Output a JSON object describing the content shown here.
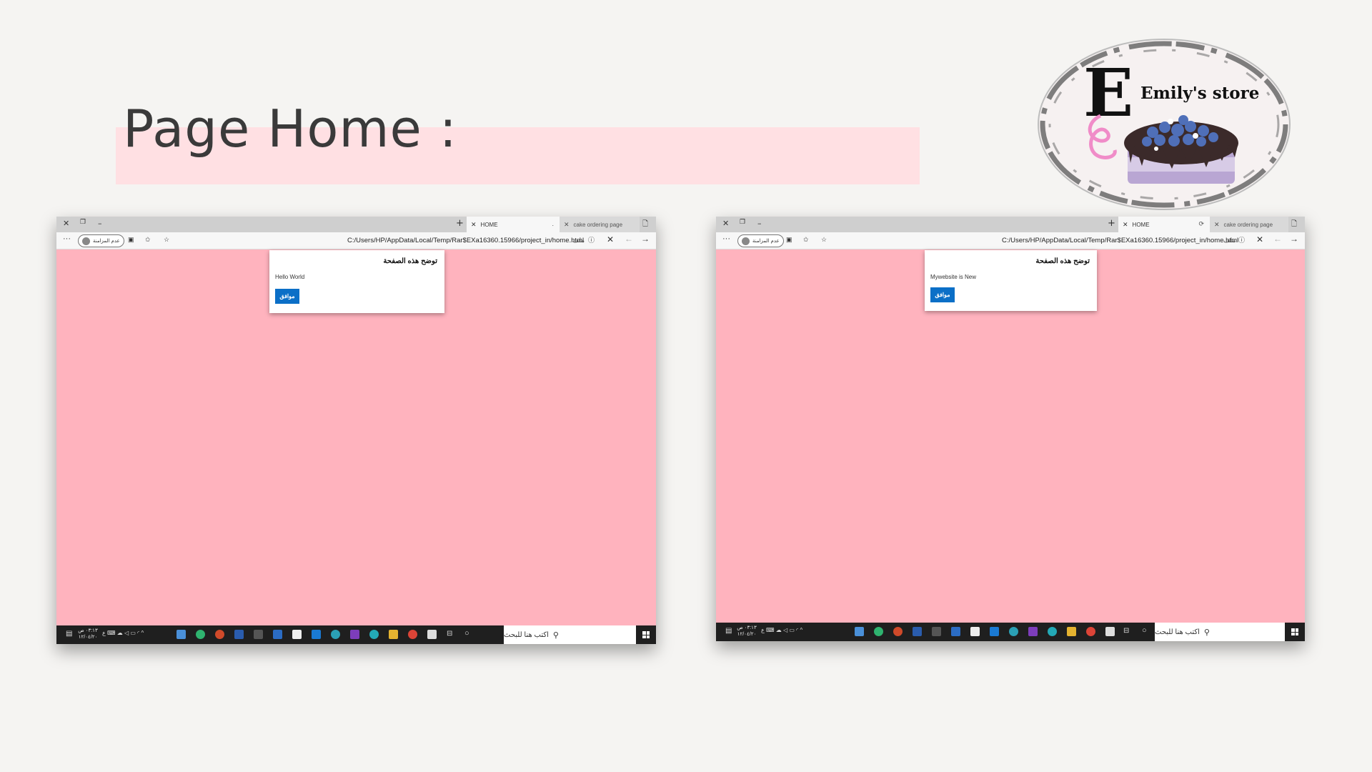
{
  "slide": {
    "title": "Page Home :",
    "logo": {
      "text": "Emily's store",
      "letter": "E"
    }
  },
  "windows": [
    {
      "id": "win1",
      "tabs": [
        {
          "label": "HOME",
          "active": true
        },
        {
          "label": "cake ordering page",
          "active": false
        }
      ],
      "url": "C:/Users/HP/AppData/Local/Temp/Rar$EXa16360.15966/project_in/home.html",
      "file_label": "ملف",
      "profile_label": "عدم المزامنة",
      "dialog": {
        "title": "توضح هذه الصفحة",
        "message": "Hello World",
        "button": "موافق"
      },
      "taskbar": {
        "search_placeholder": "اكتب هنا للبحث",
        "clock_time": "٠٣:١٣ ص",
        "clock_date": "١٢/٠٤/٢٠"
      }
    },
    {
      "id": "win2",
      "tabs": [
        {
          "label": "HOME",
          "active": true
        },
        {
          "label": "cake ordering page",
          "active": false
        }
      ],
      "url": "C:/Users/HP/AppData/Local/Temp/Rar$EXa16360.15966/project_in/home.html",
      "file_label": "ملف",
      "profile_label": "عدم المزامنة",
      "dialog": {
        "title": "توضح هذه الصفحة",
        "message": "Mywebsite is New",
        "button": "موافق"
      },
      "taskbar": {
        "search_placeholder": "اكتب هنا للبحث",
        "clock_time": "٠٣:١٣ ص",
        "clock_date": "١٢/٠٤/٢٠"
      }
    }
  ],
  "colors": {
    "page_bg": "#ffb3be",
    "title_band": "#ffe0e3",
    "dialog_button": "#0b6fc7",
    "taskbar": "#1f1f1f"
  },
  "icons": [
    "close-icon",
    "restore-icon",
    "minimize-icon",
    "new-tab-icon",
    "more-icon",
    "collections-icon",
    "favorites-icon",
    "star-icon",
    "info-icon",
    "refresh-icon",
    "back-icon",
    "forward-icon",
    "search-icon",
    "windows-start-icon",
    "notification-icon"
  ]
}
